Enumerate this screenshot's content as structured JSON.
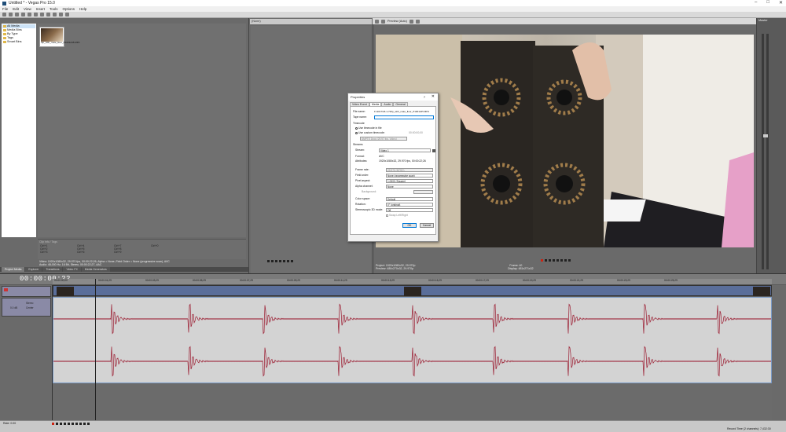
{
  "window": {
    "title": "Untitled * - Vegas Pro 15.0"
  },
  "menu": [
    "File",
    "Edit",
    "View",
    "Insert",
    "Tools",
    "Options",
    "Help"
  ],
  "explorer": {
    "tree": [
      "All Media",
      "Media Bins",
      "By Type",
      "Tags",
      "Smart Bins"
    ],
    "thumb_caption": "tap_with_mate_floor_P1001245.MP4",
    "info_header": "Clip info / Tags",
    "tags": [
      "Ctrl+1",
      "Ctrl+4",
      "Ctrl+7",
      "Ctrl+0",
      "Ctrl+2",
      "Ctrl+5",
      "Ctrl+8",
      "",
      "Ctrl+3",
      "Ctrl+6",
      "Ctrl+9",
      ""
    ],
    "props_line1": "Video: 1920x1080x32, 29.970 fps, 00:00:22;26, Alpha = None, Field Order = None (progressive scan), AVC",
    "props_line2": "Audio: 48,000 Hz, 16 Bit, Stereo, 00:00:22;27, AAC"
  },
  "left_tabs": [
    "Project Media",
    "Explorer",
    "Transitions",
    "Video FX",
    "Media Generators"
  ],
  "trimmer": {
    "header": "(None)"
  },
  "preview": {
    "label": "Preview (Auto)",
    "project": "Project: 1920x1080x32, 29.970p",
    "preview": "Preview: 480x270x32, 29.970p",
    "frame_label": "Frame:",
    "frame_value": "40",
    "display_label": "Display:",
    "display_value": "481x271x32"
  },
  "meters": {
    "title": "Master"
  },
  "timeline": {
    "timecode": "00:00:00;22",
    "ruler": [
      "00:00:00;00",
      "00:00:01;29",
      "00:00:03;29",
      "00:00:05;29",
      "00:00:07;29",
      "00:00:09;29",
      "00:00:11;29",
      "00:00:13;29",
      "00:00:15;29",
      "00:00:17;29",
      "00:00:19;29",
      "00:00:21;29",
      "00:00:23;29",
      "00:00:25;29"
    ],
    "audio_labels": {
      "vol": "0.0 dB",
      "pan": "Center",
      "track": "Stereo"
    },
    "rate": "Rate: 0.00",
    "record_time": "Record Time (2 channels): 7,432:30"
  },
  "dialog": {
    "title": "Properties",
    "help": "?",
    "close": "✕",
    "tabs": [
      "Video Event",
      "Media",
      "Audio",
      "General"
    ],
    "file_name_label": "File name:",
    "file_name": "F:\\2017\\18-1-720p_with_mate_floor_P1001245.MP4",
    "tape_name_label": "Tape name:",
    "tape_name": "",
    "timecode_label": "Timecode",
    "use_file_tc": "Use timecode in file",
    "use_custom_tc": "Use custom timecode:",
    "custom_tc_value": "00:00:00;00",
    "tc_format": "SMPTE Drop (29.97 fps, Video)",
    "streams_label": "Streams",
    "stream_label": "Stream:",
    "stream_value": "Video 1",
    "format_label": "Format:",
    "format_value": "AVC",
    "attributes_label": "Attributes:",
    "attributes_value": "1920x1080x32, 29.970 fps, 00:00:22;26",
    "frame_rate_label": "Frame rate:",
    "frame_rate_value": "29.970 (NTSC)",
    "field_order_label": "Field order:",
    "field_order_value": "None (progressive scan)",
    "pixel_aspect_label": "Pixel aspect:",
    "pixel_aspect_value": "1.0000 (Square)",
    "alpha_label": "Alpha channel:",
    "alpha_value": "None",
    "background_label": "Background:",
    "color_space_label": "Color space:",
    "color_space_value": "Default",
    "rotation_label": "Rotation:",
    "rotation_value": "0° (original)",
    "stereo_label": "Stereoscopic 3D mode:",
    "stereo_value": "Off",
    "swap_label": "Swap Left/Right",
    "ok": "OK",
    "cancel": "Cancel"
  },
  "colors": {
    "accent": "#0078d7",
    "waveform": "#9b1b30",
    "video_track": "#5a6e9a"
  }
}
